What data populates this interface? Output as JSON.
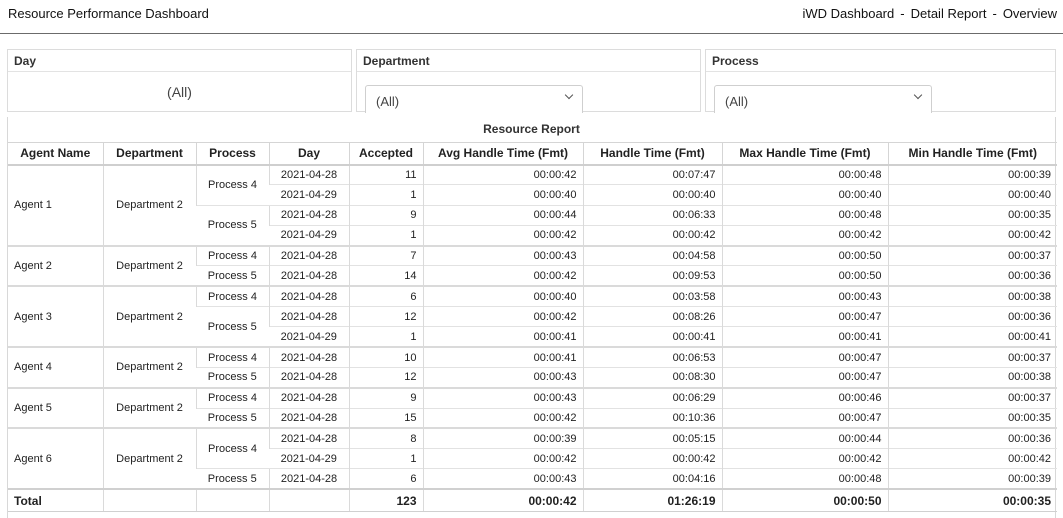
{
  "header": {
    "title": "Resource Performance Dashboard",
    "breadcrumbs": [
      "iWD Dashboard",
      "Detail Report",
      "Overview"
    ],
    "separator": "-"
  },
  "filters": {
    "day": {
      "label": "Day",
      "value": "(All)"
    },
    "department": {
      "label": "Department",
      "value": "(All)"
    },
    "process": {
      "label": "Process",
      "value": "(All)"
    }
  },
  "report": {
    "title": "Resource Report",
    "columns": [
      "Agent Name",
      "Department",
      "Process",
      "Day",
      "Accepted",
      "Avg Handle Time (Fmt)",
      "Handle Time (Fmt)",
      "Max Handle Time (Fmt)",
      "Min Handle Time (Fmt)"
    ],
    "rows": [
      [
        "Agent 1",
        "Department 2",
        "Process 4",
        "2021-04-28",
        "11",
        "00:00:42",
        "00:07:47",
        "00:00:48",
        "00:00:39"
      ],
      [
        "Agent 1",
        "Department 2",
        "Process 4",
        "2021-04-29",
        "1",
        "00:00:40",
        "00:00:40",
        "00:00:40",
        "00:00:40"
      ],
      [
        "Agent 1",
        "Department 2",
        "Process 5",
        "2021-04-28",
        "9",
        "00:00:44",
        "00:06:33",
        "00:00:48",
        "00:00:35"
      ],
      [
        "Agent 1",
        "Department 2",
        "Process 5",
        "2021-04-29",
        "1",
        "00:00:42",
        "00:00:42",
        "00:00:42",
        "00:00:42"
      ],
      [
        "Agent 2",
        "Department 2",
        "Process 4",
        "2021-04-28",
        "7",
        "00:00:43",
        "00:04:58",
        "00:00:50",
        "00:00:37"
      ],
      [
        "Agent 2",
        "Department 2",
        "Process 5",
        "2021-04-28",
        "14",
        "00:00:42",
        "00:09:53",
        "00:00:50",
        "00:00:36"
      ],
      [
        "Agent 3",
        "Department 2",
        "Process 4",
        "2021-04-28",
        "6",
        "00:00:40",
        "00:03:58",
        "00:00:43",
        "00:00:38"
      ],
      [
        "Agent 3",
        "Department 2",
        "Process 5",
        "2021-04-28",
        "12",
        "00:00:42",
        "00:08:26",
        "00:00:47",
        "00:00:36"
      ],
      [
        "Agent 3",
        "Department 2",
        "Process 5",
        "2021-04-29",
        "1",
        "00:00:41",
        "00:00:41",
        "00:00:41",
        "00:00:41"
      ],
      [
        "Agent 4",
        "Department 2",
        "Process 4",
        "2021-04-28",
        "10",
        "00:00:41",
        "00:06:53",
        "00:00:47",
        "00:00:37"
      ],
      [
        "Agent 4",
        "Department 2",
        "Process 5",
        "2021-04-28",
        "12",
        "00:00:43",
        "00:08:30",
        "00:00:47",
        "00:00:38"
      ],
      [
        "Agent 5",
        "Department 2",
        "Process 4",
        "2021-04-28",
        "9",
        "00:00:43",
        "00:06:29",
        "00:00:46",
        "00:00:37"
      ],
      [
        "Agent 5",
        "Department 2",
        "Process 5",
        "2021-04-28",
        "15",
        "00:00:42",
        "00:10:36",
        "00:00:47",
        "00:00:35"
      ],
      [
        "Agent 6",
        "Department 2",
        "Process 4",
        "2021-04-28",
        "8",
        "00:00:39",
        "00:05:15",
        "00:00:44",
        "00:00:36"
      ],
      [
        "Agent 6",
        "Department 2",
        "Process 4",
        "2021-04-29",
        "1",
        "00:00:42",
        "00:00:42",
        "00:00:42",
        "00:00:42"
      ],
      [
        "Agent 6",
        "Department 2",
        "Process 5",
        "2021-04-28",
        "6",
        "00:00:43",
        "00:04:16",
        "00:00:48",
        "00:00:39"
      ]
    ],
    "total": [
      "Total",
      "",
      "",
      "",
      "123",
      "00:00:42",
      "01:26:19",
      "00:00:50",
      "00:00:35"
    ]
  }
}
